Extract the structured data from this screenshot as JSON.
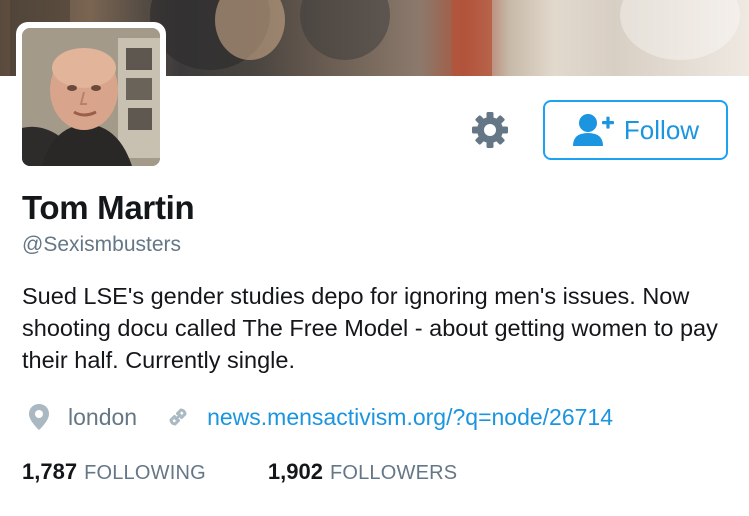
{
  "profile": {
    "name": "Tom Martin",
    "handle": "@Sexismbusters",
    "bio": "Sued LSE's gender studies depo for ignoring men's issues. Now shooting docu called The Free Model - about getting women to pay their half. Currently single.",
    "location": "london",
    "website": "news.mensactivism.org/?q=node/26714"
  },
  "actions": {
    "follow_label": "Follow",
    "settings_icon": "gear-icon",
    "follow_icon": "add-user-icon"
  },
  "stats": {
    "following_count": "1,787",
    "following_label": "FOLLOWING",
    "followers_count": "1,902",
    "followers_label": "FOLLOWERS"
  },
  "colors": {
    "accent": "#1b95e0",
    "text": "#14171a",
    "muted": "#657786"
  }
}
